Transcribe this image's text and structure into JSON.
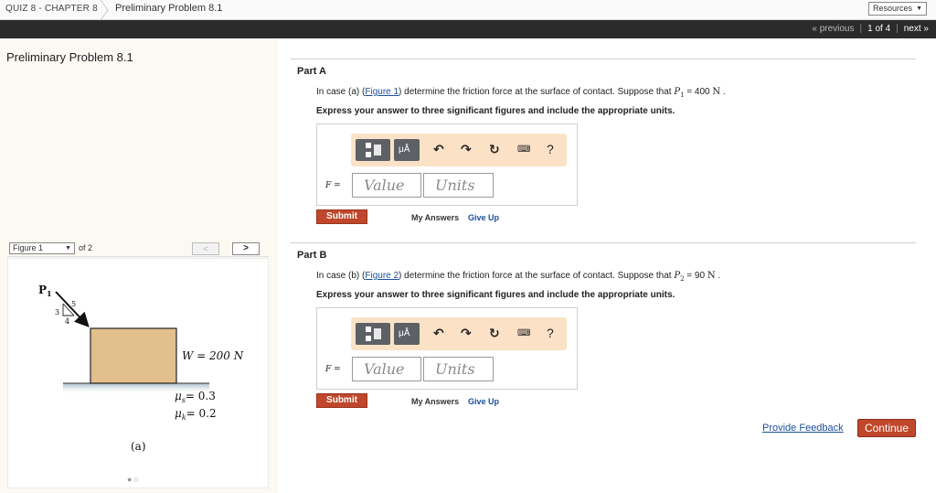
{
  "header": {
    "breadcrumb_quiz": "QUIZ 8 - CHAPTER 8",
    "breadcrumb_problem": "Preliminary Problem 8.1",
    "resources_label": "Resources"
  },
  "nav": {
    "previous_label": "« previous",
    "position_label": "1 of 4",
    "next_label": "next »"
  },
  "left": {
    "title": "Preliminary Problem 8.1",
    "figure_select_value": "Figure 1",
    "figure_of_label": "of 2",
    "prev_label": "<",
    "next_label": ">",
    "figure": {
      "p_label": "P",
      "p_sub": "1",
      "slope_5": "5",
      "slope_3": "3",
      "slope_4": "4",
      "weight_label": "W = 200 N",
      "mu_s_label": "= 0.3",
      "mu_k_label": "= 0.2",
      "mu_s_sub": "s",
      "mu_k_sub": "k",
      "mu_symbol": "μ",
      "caption": "(a)",
      "block_color": "#e2c08d"
    }
  },
  "parts": [
    {
      "title": "Part A",
      "q_before_link": "In case (a) (",
      "link": "Figure 1",
      "q_after_link": ") determine the friction force at the surface of contact. Suppose that ",
      "var": "P",
      "var_sub": "1",
      "value_text": " = 400 ",
      "unit_text": "N",
      "end": " .",
      "instruction": "Express your answer to three significant figures and include the appropriate units.",
      "answer_label": "F =",
      "value_placeholder": "Value",
      "units_placeholder": "Units",
      "submit_label": "Submit",
      "my_answers_label": "My Answers",
      "give_up_label": "Give Up"
    },
    {
      "title": "Part B",
      "q_before_link": "In case (b) (",
      "link": "Figure 2",
      "q_after_link": ") determine the friction force at the surface of contact. Suppose that ",
      "var": "P",
      "var_sub": "2",
      "value_text": " = 90 ",
      "unit_text": "N",
      "end": " .",
      "instruction": "Express your answer to three significant figures and include the appropriate units.",
      "answer_label": "F =",
      "value_placeholder": "Value",
      "units_placeholder": "Units",
      "submit_label": "Submit",
      "my_answers_label": "My Answers",
      "give_up_label": "Give Up"
    }
  ],
  "toolbar": {
    "units_icon_label": "μÅ",
    "help_label": "?"
  },
  "footer": {
    "feedback_label": "Provide Feedback",
    "continue_label": "Continue"
  },
  "colors": {
    "accent": "#c0472b",
    "link": "#1a4f9c",
    "toolbar_bg": "#fbe2c6",
    "navbar": "#2b2b2b"
  }
}
